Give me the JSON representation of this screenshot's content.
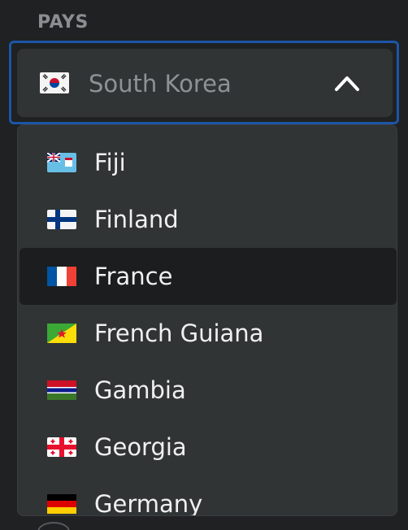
{
  "field": {
    "label": "PAYS",
    "selected_value": "South Korea",
    "selected_flag": "south-korea-flag-icon",
    "expanded_icon": "chevron-up-icon"
  },
  "options": [
    {
      "label": "Fiji",
      "flag": "fiji-flag-icon",
      "selected": false
    },
    {
      "label": "Finland",
      "flag": "finland-flag-icon",
      "selected": false
    },
    {
      "label": "France",
      "flag": "france-flag-icon",
      "selected": true
    },
    {
      "label": "French Guiana",
      "flag": "french-guiana-flag-icon",
      "selected": false
    },
    {
      "label": "Gambia",
      "flag": "gambia-flag-icon",
      "selected": false
    },
    {
      "label": "Georgia",
      "flag": "georgia-flag-icon",
      "selected": false
    },
    {
      "label": "Germany",
      "flag": "germany-flag-icon",
      "selected": false
    }
  ],
  "colors": {
    "background": "#1f2122",
    "control": "#303435",
    "focus_ring": "#1c56a6",
    "highlight": "#1b1d1e",
    "text": "#f0f0f0",
    "muted_text": "#8e9294"
  }
}
